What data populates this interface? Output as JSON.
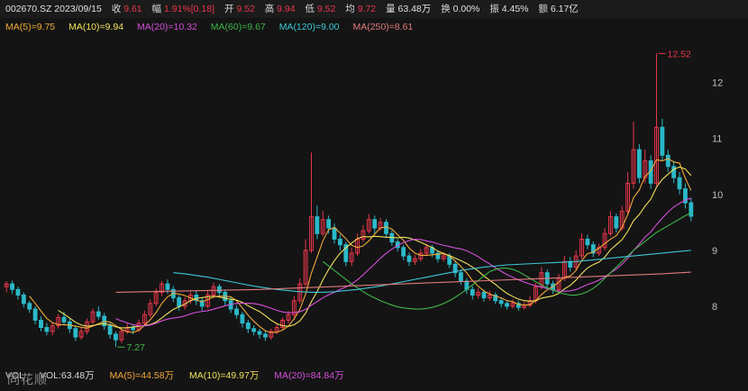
{
  "header": {
    "symbol_date": "002670.SZ 2023/09/15",
    "close_label": "收",
    "close_value": "9.61",
    "range_label": "幅",
    "range_value": "1.91%[0.18]",
    "open_label": "开",
    "open_value": "9.52",
    "high_label": "高",
    "high_value": "9.94",
    "low_label": "低",
    "low_value": "9.52",
    "avg_label": "均",
    "avg_value": "9.72",
    "vol_label": "量",
    "vol_value": "63.48万",
    "turnover_label": "换",
    "turnover_value": "0.00%",
    "amplitude_label": "振",
    "amplitude_value": "4.45%",
    "amount_label": "额",
    "amount_value": "6.17亿"
  },
  "ma_legend": [
    {
      "text": "MA(5)=9.75",
      "color": "#f2a93b"
    },
    {
      "text": "MA(10)=9.94",
      "color": "#f0e15a"
    },
    {
      "text": "MA(20)=10.32",
      "color": "#d64fdc"
    },
    {
      "text": "MA(60)=9.67",
      "color": "#3fb64a"
    },
    {
      "text": "MA(120)=9.00",
      "color": "#3ec6d6"
    },
    {
      "text": "MA(250)=8.61",
      "color": "#e07a7a"
    }
  ],
  "volume_legend": {
    "vol": "VOL",
    "vol_ma": "VOL:63.48万",
    "ma5": {
      "text": "MA(5)=44.58万",
      "color": "#f2a93b"
    },
    "ma10": {
      "text": "MA(10)=49.97万",
      "color": "#f0e15a"
    },
    "ma20": {
      "text": "MA(20)=84.84万",
      "color": "#d64fdc"
    }
  },
  "watermark": "同花顺",
  "chart_data": {
    "type": "candlestick",
    "y_ticks": [
      "8",
      "9",
      "10",
      "11",
      "12"
    ],
    "ylim": [
      7.0,
      12.8
    ],
    "annotations": [
      {
        "text": "12.52",
        "value": 12.52,
        "kind": "high",
        "color": "#e8364b"
      },
      {
        "text": "7.27",
        "value": 7.27,
        "kind": "low",
        "color": "#3fb64a"
      }
    ],
    "up_color": "#e8364b",
    "down_color": "#2bb9c9",
    "grid": false,
    "candles": [
      [
        8.35,
        8.4,
        8.45,
        8.25
      ],
      [
        8.4,
        8.3,
        8.46,
        8.22
      ],
      [
        8.3,
        8.2,
        8.35,
        8.12
      ],
      [
        8.2,
        8.05,
        8.25,
        7.98
      ],
      [
        8.05,
        7.95,
        8.1,
        7.88
      ],
      [
        7.95,
        7.75,
        8.0,
        7.68
      ],
      [
        7.75,
        7.62,
        7.82,
        7.55
      ],
      [
        7.62,
        7.55,
        7.7,
        7.48
      ],
      [
        7.55,
        7.65,
        7.72,
        7.48
      ],
      [
        7.65,
        7.8,
        7.86,
        7.6
      ],
      [
        7.8,
        7.72,
        7.9,
        7.66
      ],
      [
        7.72,
        7.6,
        7.78,
        7.52
      ],
      [
        7.6,
        7.45,
        7.66,
        7.38
      ],
      [
        7.45,
        7.55,
        7.62,
        7.4
      ],
      [
        7.55,
        7.72,
        7.78,
        7.5
      ],
      [
        7.72,
        7.9,
        7.96,
        7.68
      ],
      [
        7.9,
        7.82,
        8.0,
        7.76
      ],
      [
        7.82,
        7.65,
        7.88,
        7.58
      ],
      [
        7.65,
        7.5,
        7.7,
        7.42
      ],
      [
        7.5,
        7.4,
        7.55,
        7.27
      ],
      [
        7.4,
        7.55,
        7.6,
        7.34
      ],
      [
        7.55,
        7.62,
        7.7,
        7.5
      ],
      [
        7.62,
        7.58,
        7.68,
        7.5
      ],
      [
        7.58,
        7.7,
        7.76,
        7.54
      ],
      [
        7.7,
        7.85,
        7.92,
        7.66
      ],
      [
        7.85,
        8.05,
        8.12,
        7.8
      ],
      [
        8.05,
        8.25,
        8.32,
        8.0
      ],
      [
        8.25,
        8.4,
        8.45,
        8.18
      ],
      [
        8.4,
        8.3,
        8.48,
        8.22
      ],
      [
        8.3,
        8.15,
        8.36,
        8.08
      ],
      [
        8.15,
        8.0,
        8.2,
        7.92
      ],
      [
        8.0,
        8.1,
        8.16,
        7.94
      ],
      [
        8.1,
        8.2,
        8.26,
        8.04
      ],
      [
        8.2,
        8.1,
        8.28,
        8.02
      ],
      [
        8.1,
        8.0,
        8.16,
        7.92
      ],
      [
        8.0,
        8.2,
        8.28,
        7.96
      ],
      [
        8.2,
        8.35,
        8.42,
        8.14
      ],
      [
        8.35,
        8.25,
        8.4,
        8.18
      ],
      [
        8.25,
        8.1,
        8.3,
        8.02
      ],
      [
        8.1,
        7.95,
        8.16,
        7.88
      ],
      [
        7.95,
        7.85,
        8.02,
        7.78
      ],
      [
        7.85,
        7.7,
        7.9,
        7.62
      ],
      [
        7.7,
        7.6,
        7.76,
        7.52
      ],
      [
        7.6,
        7.55,
        7.66,
        7.48
      ],
      [
        7.55,
        7.5,
        7.6,
        7.42
      ],
      [
        7.5,
        7.45,
        7.56,
        7.38
      ],
      [
        7.45,
        7.55,
        7.6,
        7.4
      ],
      [
        7.55,
        7.62,
        7.68,
        7.5
      ],
      [
        7.62,
        7.75,
        7.8,
        7.58
      ],
      [
        7.75,
        7.85,
        7.92,
        7.7
      ],
      [
        7.85,
        8.1,
        8.18,
        7.8
      ],
      [
        8.1,
        8.4,
        8.5,
        8.05
      ],
      [
        8.4,
        9.0,
        9.2,
        8.35
      ],
      [
        9.0,
        9.6,
        10.75,
        8.95
      ],
      [
        9.6,
        9.3,
        9.8,
        9.2
      ],
      [
        9.3,
        9.55,
        9.7,
        9.25
      ],
      [
        9.55,
        9.4,
        9.62,
        9.3
      ],
      [
        9.4,
        9.2,
        9.48,
        9.12
      ],
      [
        9.2,
        9.1,
        9.28,
        9.0
      ],
      [
        9.1,
        8.8,
        9.15,
        8.72
      ],
      [
        8.8,
        8.95,
        9.05,
        8.72
      ],
      [
        8.95,
        9.2,
        9.3,
        8.9
      ],
      [
        9.2,
        9.35,
        9.45,
        9.15
      ],
      [
        9.35,
        9.55,
        9.65,
        9.3
      ],
      [
        9.55,
        9.4,
        9.62,
        9.3
      ],
      [
        9.4,
        9.5,
        9.58,
        9.35
      ],
      [
        9.5,
        9.3,
        9.56,
        9.22
      ],
      [
        9.3,
        9.15,
        9.36,
        9.08
      ],
      [
        9.15,
        9.05,
        9.2,
        8.98
      ],
      [
        9.05,
        8.9,
        9.1,
        8.82
      ],
      [
        8.9,
        8.8,
        8.96,
        8.72
      ],
      [
        8.8,
        8.85,
        8.92,
        8.74
      ],
      [
        8.85,
        8.95,
        9.02,
        8.8
      ],
      [
        8.95,
        9.05,
        9.12,
        8.9
      ],
      [
        9.05,
        8.95,
        9.1,
        8.88
      ],
      [
        8.95,
        8.85,
        9.0,
        8.78
      ],
      [
        8.85,
        8.9,
        8.96,
        8.8
      ],
      [
        8.9,
        8.75,
        8.95,
        8.68
      ],
      [
        8.75,
        8.6,
        8.8,
        8.52
      ],
      [
        8.6,
        8.45,
        8.66,
        8.38
      ],
      [
        8.45,
        8.3,
        8.5,
        8.22
      ],
      [
        8.3,
        8.2,
        8.36,
        8.12
      ],
      [
        8.2,
        8.25,
        8.32,
        8.14
      ],
      [
        8.25,
        8.15,
        8.3,
        8.08
      ],
      [
        8.15,
        8.2,
        8.28,
        8.1
      ],
      [
        8.2,
        8.1,
        8.25,
        8.04
      ],
      [
        8.1,
        8.05,
        8.16,
        7.98
      ],
      [
        8.05,
        8.0,
        8.1,
        7.94
      ],
      [
        8.0,
        8.05,
        8.12,
        7.96
      ],
      [
        8.05,
        7.98,
        8.1,
        7.92
      ],
      [
        7.98,
        8.02,
        8.08,
        7.94
      ],
      [
        8.02,
        8.1,
        8.18,
        7.98
      ],
      [
        8.1,
        8.35,
        8.42,
        8.05
      ],
      [
        8.35,
        8.6,
        8.7,
        8.3
      ],
      [
        8.6,
        8.4,
        8.66,
        8.32
      ],
      [
        8.4,
        8.3,
        8.46,
        8.22
      ],
      [
        8.3,
        8.5,
        8.58,
        8.26
      ],
      [
        8.5,
        8.8,
        8.9,
        8.45
      ],
      [
        8.8,
        8.7,
        8.88,
        8.62
      ],
      [
        8.7,
        8.9,
        9.0,
        8.65
      ],
      [
        8.9,
        9.2,
        9.3,
        8.85
      ],
      [
        9.2,
        9.1,
        9.28,
        9.02
      ],
      [
        9.1,
        8.95,
        9.16,
        8.88
      ],
      [
        8.95,
        9.05,
        9.12,
        8.9
      ],
      [
        9.05,
        9.3,
        9.4,
        9.0
      ],
      [
        9.3,
        9.6,
        9.7,
        9.25
      ],
      [
        9.6,
        9.4,
        9.66,
        9.32
      ],
      [
        9.4,
        9.7,
        9.8,
        9.35
      ],
      [
        9.7,
        10.2,
        10.4,
        9.65
      ],
      [
        10.2,
        10.8,
        11.3,
        10.1
      ],
      [
        10.8,
        10.3,
        10.9,
        10.2
      ],
      [
        10.3,
        10.6,
        10.8,
        10.2
      ],
      [
        10.6,
        10.2,
        10.7,
        10.1
      ],
      [
        10.2,
        11.2,
        12.52,
        10.15
      ],
      [
        11.2,
        10.7,
        11.35,
        10.6
      ],
      [
        10.7,
        10.5,
        10.8,
        10.4
      ],
      [
        10.5,
        10.3,
        10.6,
        10.2
      ],
      [
        10.3,
        10.1,
        10.4,
        10.0
      ],
      [
        10.1,
        9.85,
        10.2,
        9.75
      ],
      [
        9.85,
        9.61,
        9.94,
        9.52
      ]
    ],
    "ma_lines": [
      {
        "name": "MA(5)",
        "color": "#f2a93b",
        "period": 5
      },
      {
        "name": "MA(10)",
        "color": "#f0e15a",
        "period": 10
      },
      {
        "name": "MA(20)",
        "color": "#d64fdc",
        "period": 20
      },
      {
        "name": "MA(60)",
        "color": "#3fb64a",
        "series": [
          8.8,
          8.72,
          8.64,
          8.56,
          8.48,
          8.4,
          8.33,
          8.26,
          8.2,
          8.15,
          8.1,
          8.06,
          8.02,
          7.99,
          7.97,
          7.96,
          7.95,
          7.95,
          7.96,
          7.98,
          8.01,
          8.05,
          8.1,
          8.16,
          8.23,
          8.3,
          8.38,
          8.46,
          8.54,
          8.62,
          8.66,
          8.68,
          8.68,
          8.66,
          8.62,
          8.56,
          8.5,
          8.44,
          8.38,
          8.33,
          8.29,
          8.25,
          8.22,
          8.2,
          8.2,
          8.22,
          8.26,
          8.32,
          8.4,
          8.5,
          8.6,
          8.7,
          8.8,
          8.9,
          9.0,
          9.08,
          9.16,
          9.24,
          9.32,
          9.38,
          9.44,
          9.5,
          9.56,
          9.62,
          9.67
        ]
      },
      {
        "name": "MA(120)",
        "color": "#3ec6d6",
        "series": [
          8.6,
          8.58,
          8.55,
          8.52,
          8.48,
          8.44,
          8.4,
          8.36,
          8.33,
          8.3,
          8.28,
          8.26,
          8.25,
          8.25,
          8.26,
          8.28,
          8.3,
          8.33,
          8.36,
          8.4,
          8.44,
          8.48,
          8.52,
          8.56,
          8.6,
          8.64,
          8.67,
          8.7,
          8.72,
          8.74,
          8.75,
          8.76,
          8.77,
          8.78,
          8.79,
          8.8,
          8.82,
          8.84,
          8.86,
          8.88,
          8.9,
          8.92,
          8.94,
          8.96,
          8.98,
          9.0
        ]
      },
      {
        "name": "MA(250)",
        "color": "#e07a7a",
        "series": [
          8.25,
          8.26,
          8.27,
          8.28,
          8.29,
          8.3,
          8.32,
          8.34,
          8.36,
          8.38,
          8.4,
          8.42,
          8.44,
          8.46,
          8.48,
          8.5,
          8.52,
          8.54,
          8.56,
          8.58,
          8.61
        ]
      }
    ]
  }
}
